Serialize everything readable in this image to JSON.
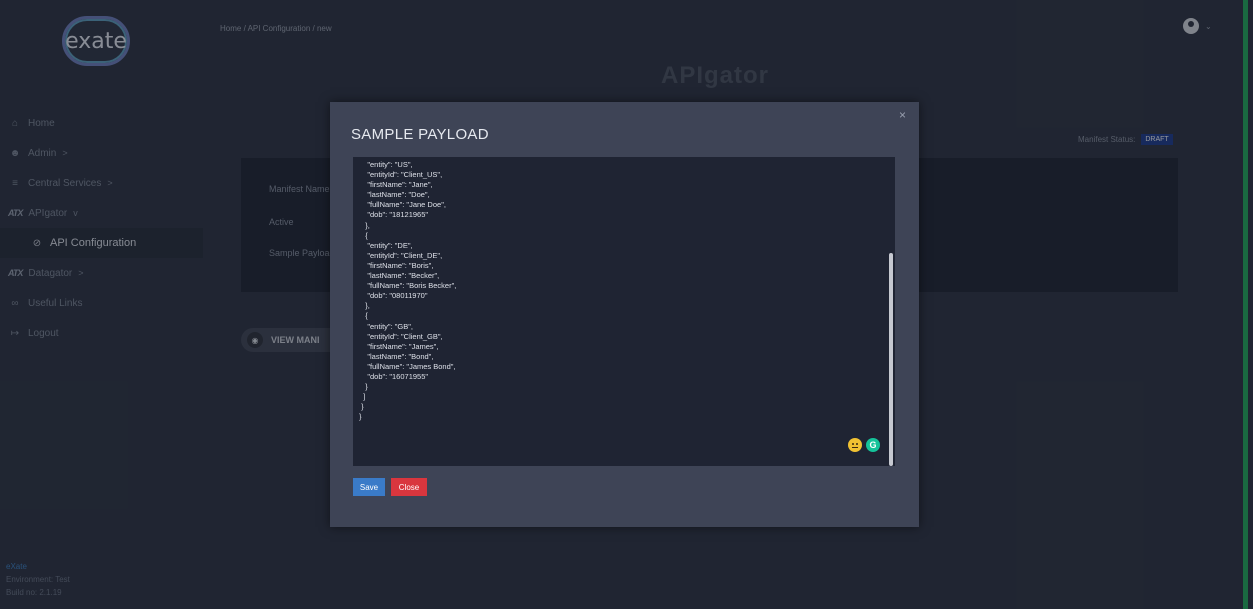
{
  "sidebar": {
    "logo_text": "exate",
    "items": [
      {
        "icon": "home-icon",
        "label": "Home"
      },
      {
        "icon": "admin-icon",
        "label": "Admin",
        "chevron": ">"
      },
      {
        "icon": "services-icon",
        "label": "Central Services",
        "chevron": ">"
      },
      {
        "icon": "atx-logo-icon",
        "label": "APIgator",
        "chevron": "v"
      },
      {
        "icon": "api-config-icon",
        "label": "API Configuration"
      },
      {
        "icon": "atx-logo-icon",
        "label": "Datagator",
        "chevron": ">"
      },
      {
        "icon": "link-icon",
        "label": "Useful Links"
      },
      {
        "icon": "logout-icon",
        "label": "Logout"
      }
    ],
    "footer": {
      "brand": "eXate",
      "environment": "Environment: Test",
      "build": "Build no: 2.1.19"
    }
  },
  "header": {
    "breadcrumb": "Home /  API Configuration /  new"
  },
  "main": {
    "logo_text": "APIgator",
    "manifest_status_label": "Manifest Status:",
    "manifest_status_value": "DRAFT",
    "fields": [
      "Manifest Name",
      "Active",
      "Sample Payload"
    ],
    "view_button_label": "VIEW MANI"
  },
  "modal": {
    "title": "SAMPLE PAYLOAD",
    "close_glyph": "×",
    "payload_text": "    \"entity\": \"US\",\n    \"entityId\": \"Client_US\",\n    \"firstName\": \"Jane\",\n    \"lastName\": \"Doe\",\n    \"fullName\": \"Jane Doe\",\n    \"dob\": \"18121965\"\n   },\n   {\n    \"entity\": \"DE\",\n    \"entityId\": \"Client_DE\",\n    \"firstName\": \"Boris\",\n    \"lastName\": \"Becker\",\n    \"fullName\": \"Boris Becker\",\n    \"dob\": \"08011970\"\n   },\n   {\n    \"entity\": \"GB\",\n    \"entityId\": \"Client_GB\",\n    \"firstName\": \"James\",\n    \"lastName\": \"Bond\",\n    \"fullName\": \"James Bond\",\n    \"dob\": \"16071955\"\n   }\n  ]\n }\n}",
    "save_label": "Save",
    "close_label": "Close",
    "grammarly_glyph": "G"
  },
  "colors": {
    "accent": "#3a7bc8",
    "danger": "#d9363e",
    "draft_badge": "#1b3a8e",
    "edge_green": "#1fae5c"
  }
}
